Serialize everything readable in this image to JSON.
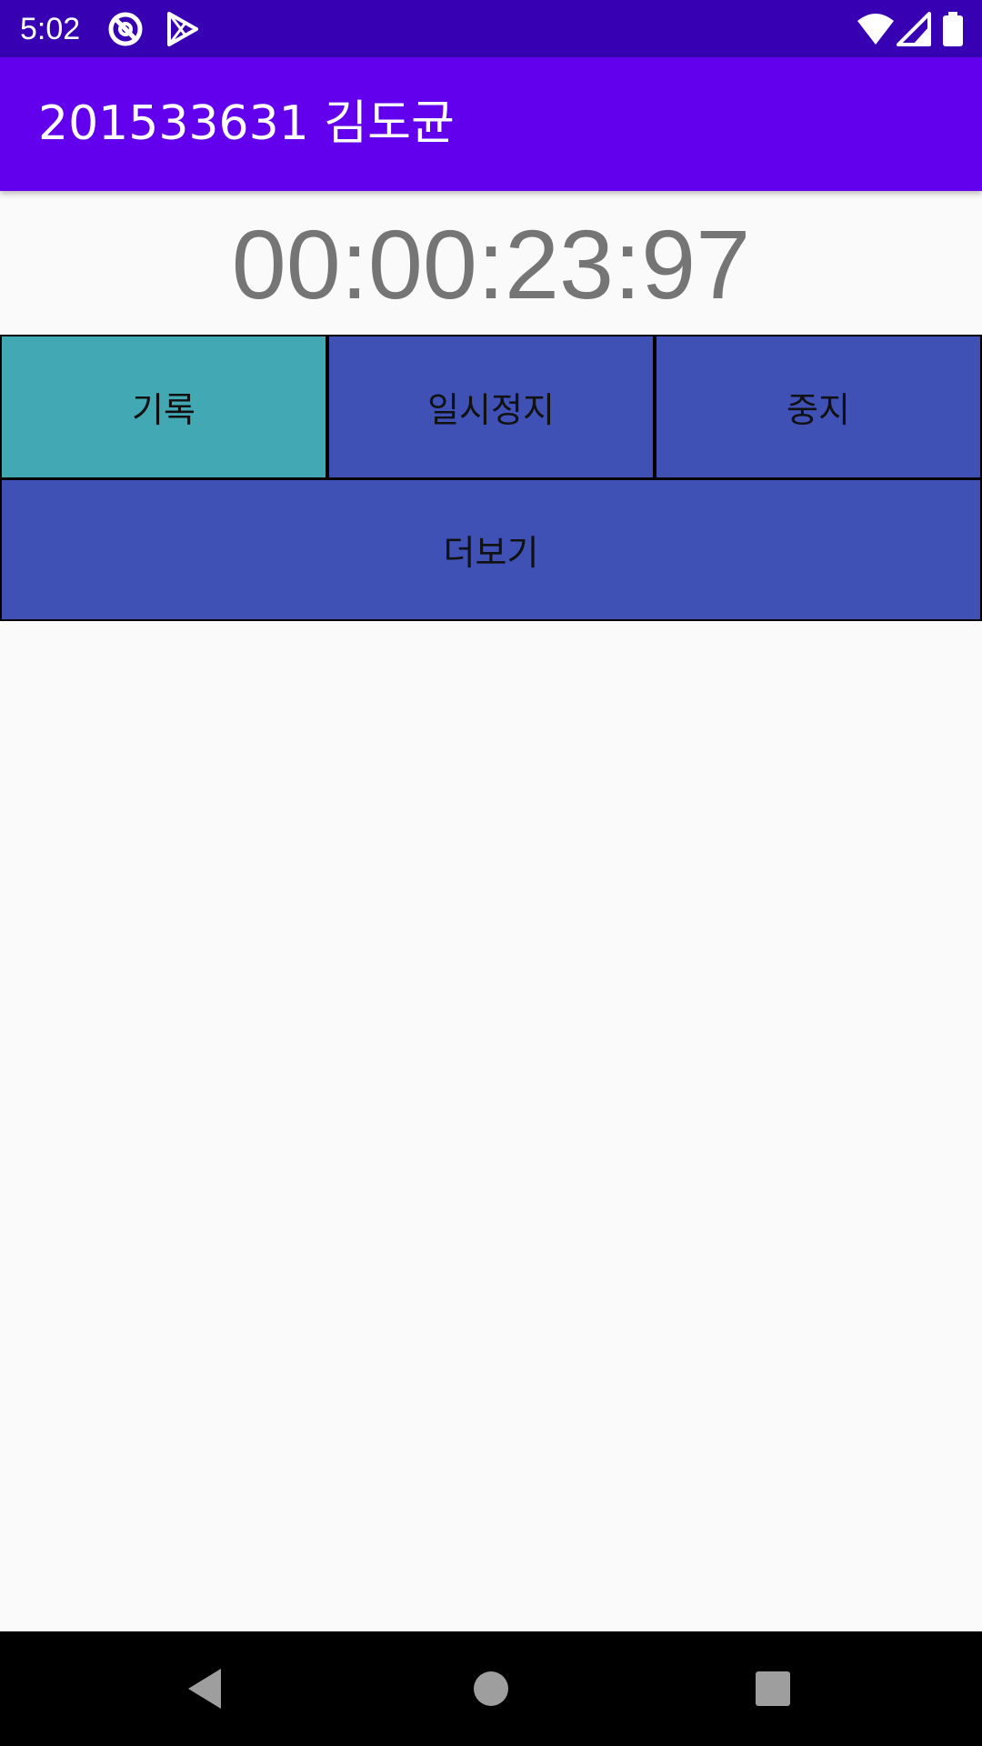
{
  "status_bar": {
    "time": "5:02",
    "icons": [
      "sync-disabled-icon",
      "play-store-icon",
      "wifi-icon",
      "cell-signal-icon",
      "battery-icon"
    ],
    "background": "#3700b3"
  },
  "app_bar": {
    "title": "201533631 김도균",
    "background": "#6200ee"
  },
  "stopwatch": {
    "display": "00:00:23:97"
  },
  "buttons": {
    "record": "기록",
    "pause": "일시정지",
    "stop": "중지",
    "more": "더보기"
  },
  "colors": {
    "record_button": "#42a8b4",
    "primary_button": "#3f51b5"
  },
  "nav_bar": {
    "icons": [
      "back-icon",
      "home-icon",
      "recents-icon"
    ]
  }
}
